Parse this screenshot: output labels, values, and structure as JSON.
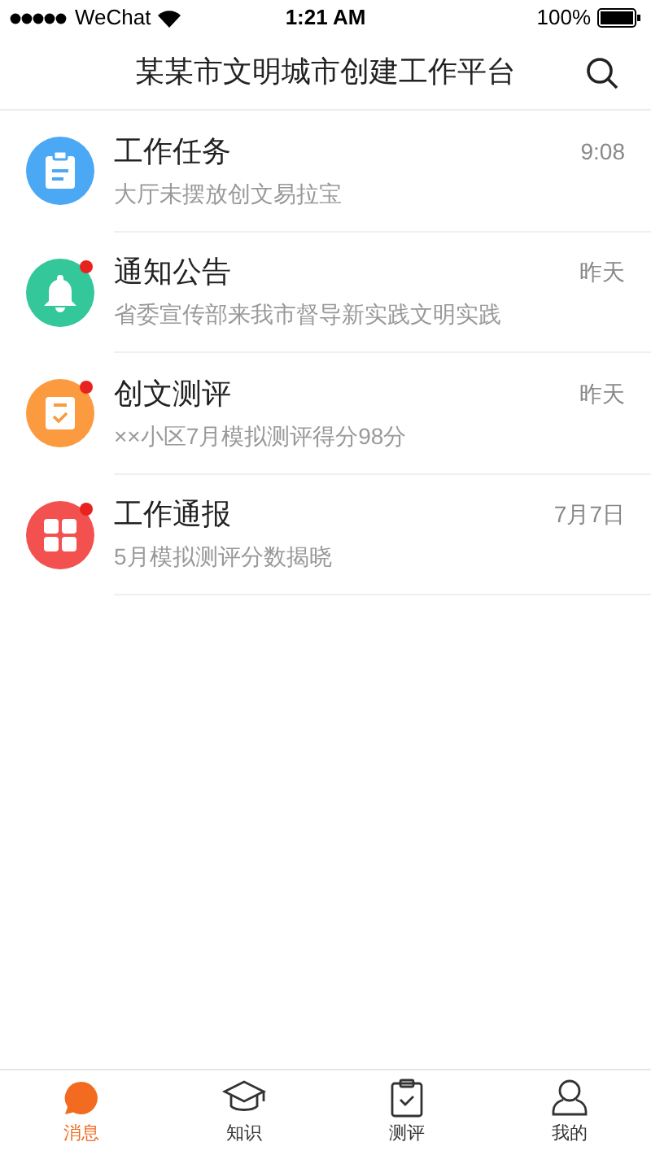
{
  "status_bar": {
    "carrier": "WeChat",
    "time": "1:21 AM",
    "battery": "100%"
  },
  "header": {
    "title": "某某市文明城市创建工作平台"
  },
  "messages": [
    {
      "kind": "clipboard",
      "color": "#4aa8f5",
      "title": "工作任务",
      "preview": "大厅未摆放创文易拉宝",
      "time": "9:08",
      "unread": false
    },
    {
      "kind": "bell",
      "color": "#33c79a",
      "title": "通知公告",
      "preview": "省委宣传部来我市督导新实践文明实践",
      "time": "昨天",
      "unread": true
    },
    {
      "kind": "checklist",
      "color": "#fb9a3e",
      "title": "创文测评",
      "preview": "××小区7月模拟测评得分98分",
      "time": "昨天",
      "unread": true
    },
    {
      "kind": "grid",
      "color": "#f2514f",
      "title": "工作通报",
      "preview": "5月模拟测评分数揭晓",
      "time": "7月7日",
      "unread": true
    }
  ],
  "tabs": [
    {
      "kind": "chat",
      "label": "消息",
      "selected": true
    },
    {
      "kind": "cap",
      "label": "知识",
      "selected": false
    },
    {
      "kind": "clipboard",
      "label": "测评",
      "selected": false
    },
    {
      "kind": "person",
      "label": "我的",
      "selected": false
    }
  ]
}
